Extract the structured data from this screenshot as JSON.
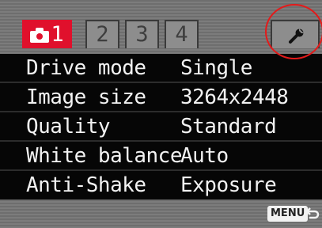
{
  "tabs": [
    {
      "label": "1",
      "icon": "camera-icon",
      "active": true
    },
    {
      "label": "2",
      "active": false
    },
    {
      "label": "3",
      "active": false
    },
    {
      "label": "4",
      "active": false
    }
  ],
  "setup_tab": {
    "icon": "wrench-icon"
  },
  "menu": {
    "items": [
      {
        "label": "Drive mode",
        "value": "Single"
      },
      {
        "label": "Image size",
        "value": "3264x2448"
      },
      {
        "label": "Quality",
        "value": "Standard"
      },
      {
        "label": "White balance",
        "value": "Auto"
      },
      {
        "label": "Anti-Shake",
        "value": "Exposure"
      }
    ]
  },
  "footer": {
    "menu_label": "MENU",
    "back_icon": "return-arrow-icon"
  },
  "colors": {
    "active_tab": "#e0102c",
    "highlight_ring": "#e41a1a",
    "text": "#f2f2f2"
  }
}
